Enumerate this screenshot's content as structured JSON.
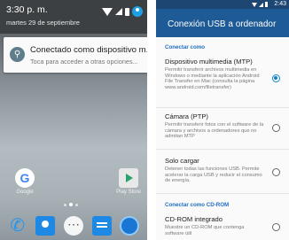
{
  "left_phone": {
    "status": {
      "time": "3:30 p. m.",
      "date": "martes 29 de septiembre"
    },
    "notification": {
      "icon": "usb-icon",
      "title": "Conectado como dispositivo m...",
      "text": "Toca para acceder a otras opciones..."
    },
    "home_apps": [
      {
        "label": "Google",
        "icon": "google-icon"
      },
      {
        "label": "Play Store",
        "icon": "play-store-icon"
      }
    ],
    "dock": [
      "phone-icon",
      "contacts-icon",
      "app-drawer-icon",
      "messages-icon",
      "browser-icon"
    ],
    "page_indicator": {
      "pages": 3,
      "active": 2
    }
  },
  "right_phone": {
    "status_time": "2:43",
    "app_bar_title": "Conexión USB a ordenador",
    "sections": [
      {
        "header": "Conectar como",
        "options": [
          {
            "title": "Dispositivo multimedia (MTP)",
            "summary": "Permitir transferir archivos multimedia en Windows o mediante la aplicación Android File Transfer en Mac (consulta la página www.android.com/filetransfer)",
            "checked": true
          },
          {
            "title": "Cámara (PTP)",
            "summary": "Permitir transferir fotos con el software de la cámara y archivos a ordenadores que no admitan MTP",
            "checked": false
          },
          {
            "title": "Solo cargar",
            "summary": "Detener todas las funciones USB. Permite acelerar la carga USB y reducir el consumo de energía.",
            "checked": false
          }
        ]
      },
      {
        "header": "Conectar como CD-ROM",
        "options": [
          {
            "title": "CD-ROM integrado",
            "summary": "Muestre un CD-ROM que contenga software útil",
            "checked": false
          }
        ]
      }
    ],
    "accent_color": "#1e5a96"
  }
}
